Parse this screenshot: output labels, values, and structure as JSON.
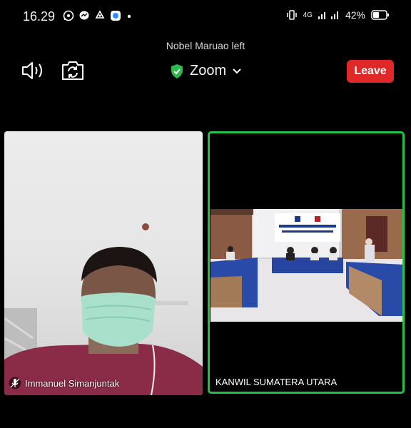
{
  "status_bar": {
    "time": "16.29",
    "network": "4G",
    "battery": "42%"
  },
  "notice": "Nobel Maruao left",
  "toolbar": {
    "title": "Zoom",
    "leave_label": "Leave"
  },
  "participants": [
    {
      "name": "Immanuel Simanjuntak"
    },
    {
      "name": "KANWIL SUMATERA UTARA"
    }
  ],
  "colors": {
    "leave": "#e02828",
    "active_speaker_border": "#23c247",
    "secure_shield": "#2eb84f"
  }
}
